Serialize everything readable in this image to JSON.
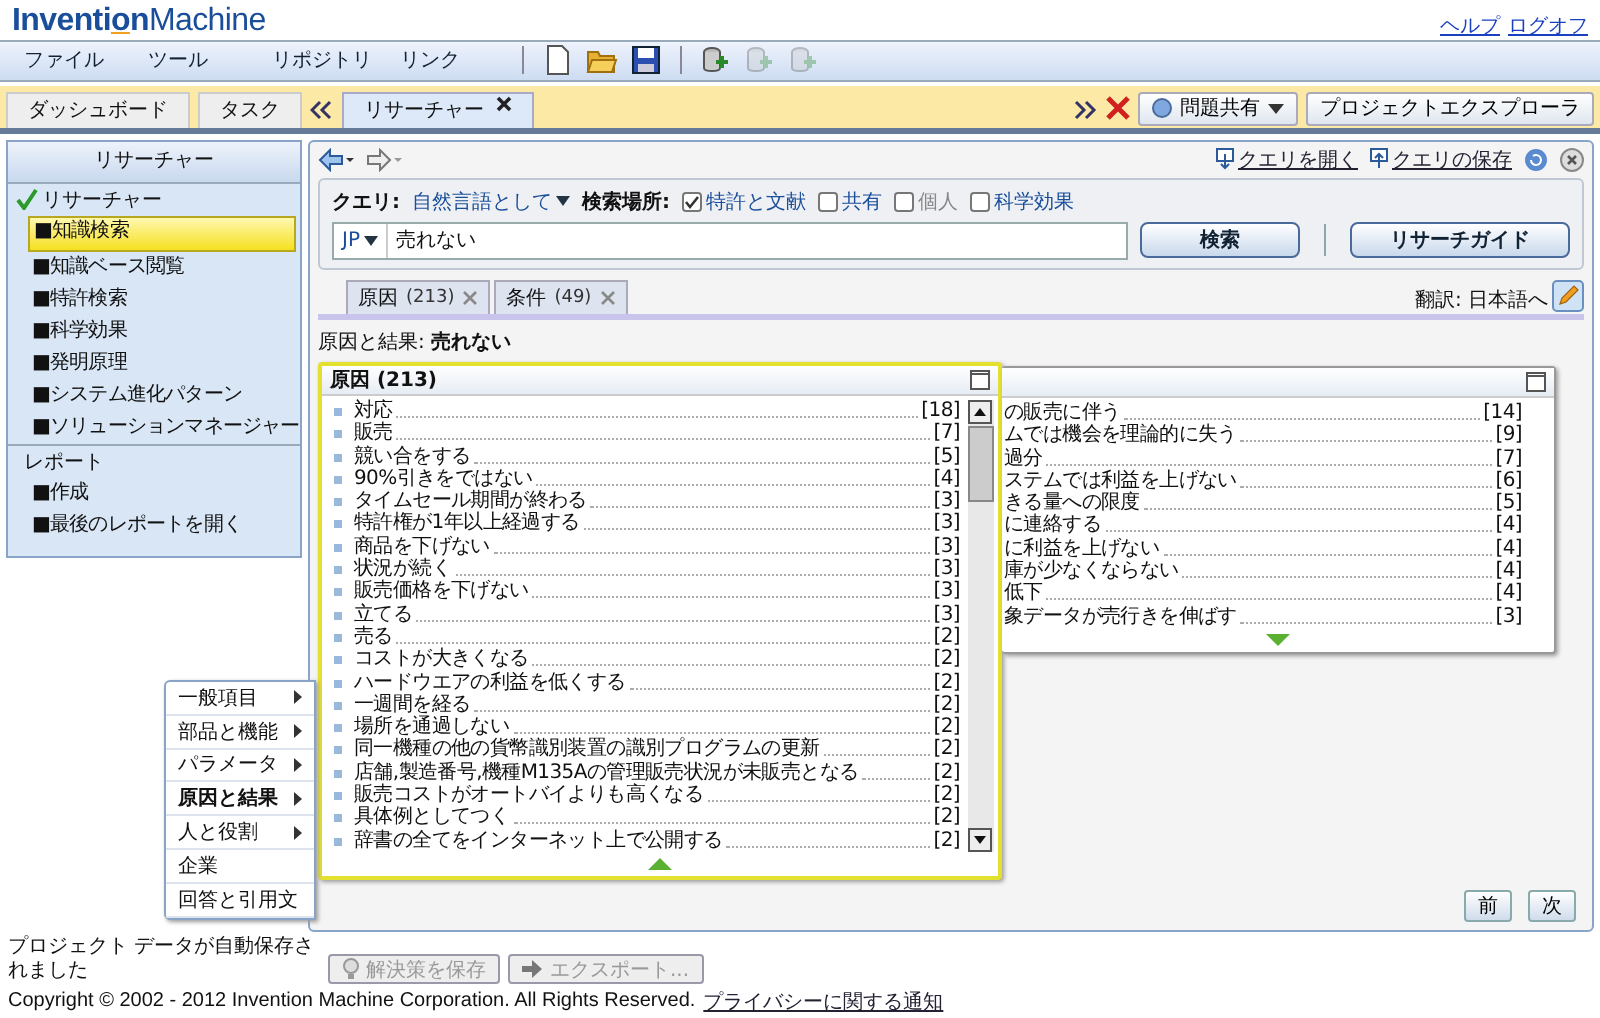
{
  "header": {
    "logo_bold": "Inventi",
    "logo_o": "o",
    "logo_n": "n",
    "logo_rest": "Machine",
    "links": [
      {
        "label": "ヘルプ"
      },
      {
        "label": "ログオフ"
      }
    ]
  },
  "menubar": {
    "items": [
      "ファイル",
      "ツール",
      "リポジトリ",
      "リンク"
    ],
    "tools": [
      {
        "kind": "new",
        "disabled": false
      },
      {
        "kind": "open",
        "disabled": false
      },
      {
        "kind": "save",
        "disabled": false
      },
      {
        "kind": "db",
        "disabled": false
      },
      {
        "kind": "db",
        "disabled": true
      },
      {
        "kind": "db",
        "disabled": true
      }
    ]
  },
  "tabs": [
    {
      "label": "ダッシュボード",
      "selected": false,
      "closable": false
    },
    {
      "label": "タスク",
      "selected": false,
      "closable": false
    },
    {
      "label": "リサーチャー",
      "selected": true,
      "closable": true
    }
  ],
  "tab_actions": {
    "share": "問題共有",
    "explorer": "プロジェクトエクスプローラ"
  },
  "sidebar": {
    "title": "リサーチャー",
    "sections": [
      {
        "label": "リサーチャー",
        "checked": true,
        "items": [
          {
            "label": "■知識検索",
            "selected": true
          },
          {
            "label": "■知識ベース閲覧",
            "selected": false
          },
          {
            "label": "■特許検索",
            "selected": false
          },
          {
            "label": "■科学効果",
            "selected": false
          },
          {
            "label": "■発明原理",
            "selected": false
          },
          {
            "label": "■システム進化パターン",
            "selected": false
          },
          {
            "label": "■ソリューションマネージャー",
            "selected": false
          }
        ]
      },
      {
        "label": "レポート",
        "checked": false,
        "items": [
          {
            "label": "■作成",
            "selected": false
          },
          {
            "label": "■最後のレポートを開く",
            "selected": false
          }
        ]
      }
    ]
  },
  "nav": {
    "links": [
      {
        "label": "クエリを開く",
        "kind": "open"
      },
      {
        "label": "クエリの保存",
        "kind": "save"
      }
    ]
  },
  "query": {
    "label": "クエリ:",
    "mode": "自然言語として",
    "scope_label": "検索場所:",
    "scopes": [
      {
        "label": "特許と文献",
        "checked": true,
        "disabled": false
      },
      {
        "label": "共有",
        "checked": false,
        "disabled": false
      },
      {
        "label": "個人",
        "checked": false,
        "disabled": true
      },
      {
        "label": "科学効果",
        "checked": false,
        "disabled": false
      }
    ],
    "lang": "JP",
    "value": "売れない",
    "search": "検索",
    "guide": "リサーチガイド"
  },
  "result_tabs": [
    {
      "label": "原因",
      "count": "(213)"
    },
    {
      "label": "条件",
      "count": "(49)"
    }
  ],
  "translate": "翻訳: 日本語へ",
  "heading": {
    "label": "原因と結果:",
    "value": "売れない"
  },
  "panels": [
    {
      "title": "原因 (213)",
      "focused": true,
      "expanded": true,
      "items": [
        {
          "text": "対応",
          "count": "[18]"
        },
        {
          "text": "販売",
          "count": "[7]"
        },
        {
          "text": "競い合をする",
          "count": "[5]"
        },
        {
          "text": "90%引きをではない",
          "count": "[4]"
        },
        {
          "text": "タイムセール期間が終わる",
          "count": "[3]"
        },
        {
          "text": "特許権が1年以上経過する",
          "count": "[3]"
        },
        {
          "text": "商品を下げない",
          "count": "[3]"
        },
        {
          "text": "状況が続く",
          "count": "[3]"
        },
        {
          "text": "販売価格を下げない",
          "count": "[3]"
        },
        {
          "text": "立てる",
          "count": "[3]"
        },
        {
          "text": "売る",
          "count": "[2]"
        },
        {
          "text": "コストが大きくなる",
          "count": "[2]"
        },
        {
          "text": "ハードウエアの利益を低くする",
          "count": "[2]"
        },
        {
          "text": "一週間を経る",
          "count": "[2]"
        },
        {
          "text": "場所を通過しない",
          "count": "[2]"
        },
        {
          "text": "同一機種の他の貨幣識別装置の識別プログラムの更新",
          "count": "[2]"
        },
        {
          "text": "店舗,製造番号,機種M135Aの管理販売状況が未販売となる",
          "count": "[2]"
        },
        {
          "text": "販売コストがオートバイよりも高くなる",
          "count": "[2]"
        },
        {
          "text": "具体例としてつく",
          "count": "[2]"
        },
        {
          "text": "辞書の全てをインターネット上で公開する",
          "count": "[2]"
        }
      ]
    },
    {
      "focused": false,
      "expanded": false,
      "items": [
        {
          "text": "の販売に伴う",
          "count": "[14]"
        },
        {
          "text": "ムでは機会を理論的に失う",
          "count": "[9]"
        },
        {
          "text": "過分",
          "count": "[7]"
        },
        {
          "text": "ステムでは利益を上げない",
          "count": "[6]"
        },
        {
          "text": "きる量への限度",
          "count": "[5]"
        },
        {
          "text": "に連絡する",
          "count": "[4]"
        },
        {
          "text": "に利益を上げない",
          "count": "[4]"
        },
        {
          "text": "庫が少なくならない",
          "count": "[4]"
        },
        {
          "text": "低下",
          "count": "[4]"
        },
        {
          "text": "象データが売行きを伸ばす",
          "count": "[3]"
        }
      ]
    }
  ],
  "context_menu": [
    {
      "label": "一般項目",
      "submenu": true,
      "selected": false
    },
    {
      "label": "部品と機能",
      "submenu": true,
      "selected": false
    },
    {
      "label": "パラメータ",
      "submenu": true,
      "selected": false
    },
    {
      "label": "原因と結果",
      "submenu": true,
      "selected": true
    },
    {
      "label": "人と役割",
      "submenu": true,
      "selected": false
    },
    {
      "label": "企業",
      "submenu": false,
      "selected": false
    },
    {
      "label": "回答と引用文",
      "submenu": false,
      "selected": false
    }
  ],
  "status": {
    "message": "プロジェクト データが自動保存されました",
    "actions": [
      {
        "label": "解決策を保存",
        "kind": "bulb",
        "disabled": true
      },
      {
        "label": "エクスポート...",
        "kind": "export",
        "disabled": true
      }
    ],
    "prev": "前",
    "next": "次"
  },
  "footer": {
    "copyright": "Copyright © 2002 - 2012 Invention Machine Corporation. All Rights Reserved.",
    "link": "プライバシーに関する通知"
  }
}
